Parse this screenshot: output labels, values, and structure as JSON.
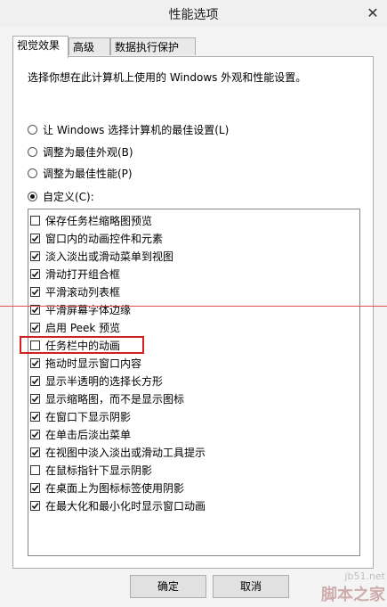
{
  "window": {
    "title": "性能选项",
    "close_glyph": "✕"
  },
  "tabs": [
    "视觉效果",
    "高级",
    "数据执行保护"
  ],
  "description": "选择你想在此计算机上使用的 Windows 外观和性能设置。",
  "options": [
    {
      "label": "让 Windows 选择计算机的最佳设置(L)",
      "selected": false
    },
    {
      "label": "调整为最佳外观(B)",
      "selected": false
    },
    {
      "label": "调整为最佳性能(P)",
      "selected": false
    },
    {
      "label": "自定义(C):",
      "selected": true
    }
  ],
  "effects": [
    {
      "label": "保存任务栏缩略图预览",
      "checked": false
    },
    {
      "label": "窗口内的动画控件和元素",
      "checked": true
    },
    {
      "label": "淡入淡出或滑动菜单到视图",
      "checked": true
    },
    {
      "label": "滑动打开组合框",
      "checked": true
    },
    {
      "label": "平滑滚动列表框",
      "checked": true
    },
    {
      "label": "平滑屏幕字体边缘",
      "checked": true
    },
    {
      "label": "启用 Peek 预览",
      "checked": true
    },
    {
      "label": "任务栏中的动画",
      "checked": false
    },
    {
      "label": "拖动时显示窗口内容",
      "checked": true
    },
    {
      "label": "显示半透明的选择长方形",
      "checked": true
    },
    {
      "label": "显示缩略图，而不是显示图标",
      "checked": true
    },
    {
      "label": "在窗口下显示阴影",
      "checked": true
    },
    {
      "label": "在单击后淡出菜单",
      "checked": true
    },
    {
      "label": "在视图中淡入淡出或滑动工具提示",
      "checked": true
    },
    {
      "label": "在鼠标指针下显示阴影",
      "checked": false
    },
    {
      "label": "在桌面上为图标标签使用阴影",
      "checked": true
    },
    {
      "label": "在最大化和最小化时显示窗口动画",
      "checked": true
    }
  ],
  "buttons": {
    "ok": "确定",
    "cancel": "取消"
  },
  "watermark": {
    "line1": "jb51.net",
    "line2": "脚本之家"
  },
  "colors": {
    "highlight": "#d22020"
  }
}
